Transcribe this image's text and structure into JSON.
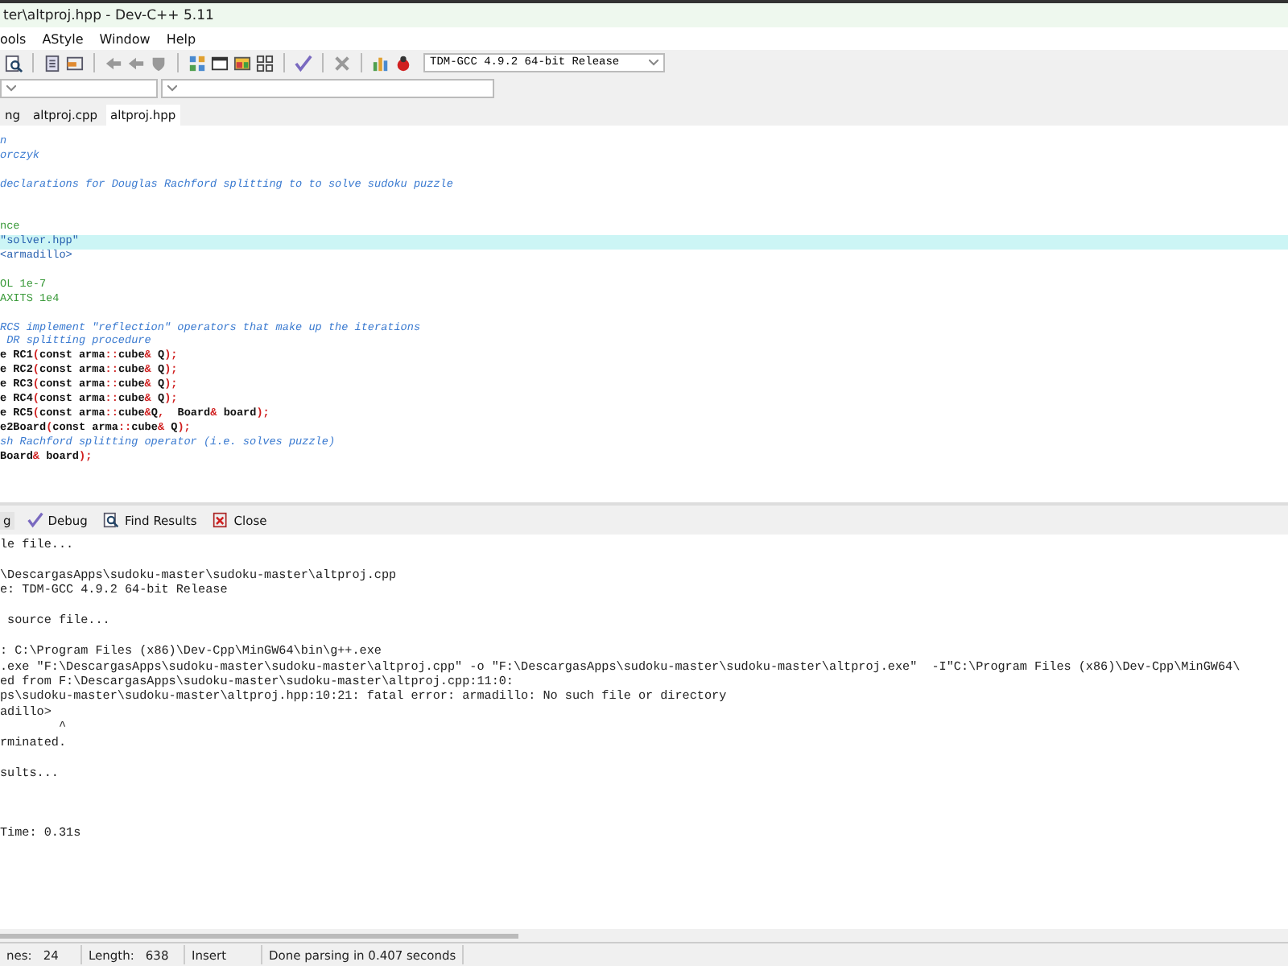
{
  "window": {
    "title": "ter\\altproj.hpp - Dev-C++ 5.11"
  },
  "menu": [
    "ools",
    "AStyle",
    "Window",
    "Help"
  ],
  "toolbar": {
    "compiler": "TDM-GCC 4.9.2 64-bit Release"
  },
  "editor_tabs": [
    {
      "label": "ng",
      "selected": false
    },
    {
      "label": "altproj.cpp",
      "selected": false
    },
    {
      "label": "altproj.hpp",
      "selected": true
    }
  ],
  "code_lines": [
    {
      "highlighted": false,
      "segments": [
        {
          "text": "n",
          "kind": "comment"
        }
      ]
    },
    {
      "highlighted": false,
      "segments": [
        {
          "text": "orczyk",
          "kind": "comment"
        }
      ]
    },
    {
      "kind": "blank"
    },
    {
      "highlighted": false,
      "segments": [
        {
          "text": "declarations for Douglas Rachford splitting to to solve sudoku puzzle",
          "kind": "comment"
        }
      ]
    },
    {
      "kind": "blank"
    },
    {
      "kind": "blank"
    },
    {
      "highlighted": false,
      "segments": [
        {
          "text": "nce",
          "kind": "preproc"
        }
      ]
    },
    {
      "highlighted": true,
      "segments": [
        {
          "text": "\"solver.hpp\"",
          "kind": "string"
        }
      ]
    },
    {
      "highlighted": false,
      "segments": [
        {
          "text": "<armadillo>",
          "kind": "string"
        }
      ]
    },
    {
      "kind": "blank"
    },
    {
      "highlighted": false,
      "segments": [
        {
          "text": "OL 1e-7",
          "kind": "preproc"
        }
      ]
    },
    {
      "highlighted": false,
      "segments": [
        {
          "text": "AXITS 1e4",
          "kind": "preproc"
        }
      ]
    },
    {
      "kind": "blank"
    },
    {
      "highlighted": false,
      "segments": [
        {
          "text": "RCS implement \"reflection\" operators that make up the iterations",
          "kind": "comment"
        }
      ]
    },
    {
      "highlighted": false,
      "segments": [
        {
          "text": " DR splitting procedure",
          "kind": "comment"
        }
      ]
    },
    {
      "highlighted": false,
      "segments": [
        {
          "text": "e RC1",
          "kind": "plain"
        },
        {
          "text": "(",
          "kind": "symbol"
        },
        {
          "text": "const arma",
          "kind": "plain"
        },
        {
          "text": "::",
          "kind": "symbol"
        },
        {
          "text": "cube",
          "kind": "plain"
        },
        {
          "text": "&",
          "kind": "symbol"
        },
        {
          "text": " Q",
          "kind": "plain"
        },
        {
          "text": ");",
          "kind": "symbol"
        }
      ]
    },
    {
      "highlighted": false,
      "segments": [
        {
          "text": "e RC2",
          "kind": "plain"
        },
        {
          "text": "(",
          "kind": "symbol"
        },
        {
          "text": "const arma",
          "kind": "plain"
        },
        {
          "text": "::",
          "kind": "symbol"
        },
        {
          "text": "cube",
          "kind": "plain"
        },
        {
          "text": "&",
          "kind": "symbol"
        },
        {
          "text": " Q",
          "kind": "plain"
        },
        {
          "text": ");",
          "kind": "symbol"
        }
      ]
    },
    {
      "highlighted": false,
      "segments": [
        {
          "text": "e RC3",
          "kind": "plain"
        },
        {
          "text": "(",
          "kind": "symbol"
        },
        {
          "text": "const arma",
          "kind": "plain"
        },
        {
          "text": "::",
          "kind": "symbol"
        },
        {
          "text": "cube",
          "kind": "plain"
        },
        {
          "text": "&",
          "kind": "symbol"
        },
        {
          "text": " Q",
          "kind": "plain"
        },
        {
          "text": ");",
          "kind": "symbol"
        }
      ]
    },
    {
      "highlighted": false,
      "segments": [
        {
          "text": "e RC4",
          "kind": "plain"
        },
        {
          "text": "(",
          "kind": "symbol"
        },
        {
          "text": "const arma",
          "kind": "plain"
        },
        {
          "text": "::",
          "kind": "symbol"
        },
        {
          "text": "cube",
          "kind": "plain"
        },
        {
          "text": "&",
          "kind": "symbol"
        },
        {
          "text": " Q",
          "kind": "plain"
        },
        {
          "text": ");",
          "kind": "symbol"
        }
      ]
    },
    {
      "highlighted": false,
      "segments": [
        {
          "text": "e RC5",
          "kind": "plain"
        },
        {
          "text": "(",
          "kind": "symbol"
        },
        {
          "text": "const arma",
          "kind": "plain"
        },
        {
          "text": "::",
          "kind": "symbol"
        },
        {
          "text": "cube",
          "kind": "plain"
        },
        {
          "text": "&",
          "kind": "symbol"
        },
        {
          "text": "Q",
          "kind": "plain"
        },
        {
          "text": ",",
          "kind": "symbol"
        },
        {
          "text": "  Board",
          "kind": "plain"
        },
        {
          "text": "&",
          "kind": "symbol"
        },
        {
          "text": " board",
          "kind": "plain"
        },
        {
          "text": ");",
          "kind": "symbol"
        }
      ]
    },
    {
      "highlighted": false,
      "segments": [
        {
          "text": "e2Board",
          "kind": "plain"
        },
        {
          "text": "(",
          "kind": "symbol"
        },
        {
          "text": "const arma",
          "kind": "plain"
        },
        {
          "text": "::",
          "kind": "symbol"
        },
        {
          "text": "cube",
          "kind": "plain"
        },
        {
          "text": "&",
          "kind": "symbol"
        },
        {
          "text": " Q",
          "kind": "plain"
        },
        {
          "text": ");",
          "kind": "symbol"
        }
      ]
    },
    {
      "highlighted": false,
      "segments": [
        {
          "text": "sh Rachford splitting operator (i.e. solves puzzle)",
          "kind": "comment"
        }
      ]
    },
    {
      "highlighted": false,
      "segments": [
        {
          "text": "Board",
          "kind": "plain"
        },
        {
          "text": "&",
          "kind": "symbol"
        },
        {
          "text": " board",
          "kind": "plain"
        },
        {
          "text": ");",
          "kind": "symbol"
        }
      ]
    }
  ],
  "output_tabs": [
    {
      "label": "g",
      "kind": "log",
      "selected": true
    },
    {
      "label": "Debug",
      "kind": "debug",
      "selected": false
    },
    {
      "label": "Find Results",
      "kind": "find",
      "selected": false
    },
    {
      "label": "Close",
      "kind": "close",
      "selected": false
    }
  ],
  "output_lines": [
    {
      "kind": "text",
      "text": "le file..."
    },
    {
      "kind": "blank"
    },
    {
      "kind": "text",
      "text": "\\DescargasApps\\sudoku-master\\sudoku-master\\altproj.cpp"
    },
    {
      "kind": "text",
      "text": "e: TDM-GCC 4.9.2 64-bit Release"
    },
    {
      "kind": "blank"
    },
    {
      "kind": "text",
      "text": " source file..."
    },
    {
      "kind": "blank"
    },
    {
      "kind": "text",
      "text": ": C:\\Program Files (x86)\\Dev-Cpp\\MinGW64\\bin\\g++.exe"
    },
    {
      "kind": "text",
      "text": ".exe \"F:\\DescargasApps\\sudoku-master\\sudoku-master\\altproj.cpp\" -o \"F:\\DescargasApps\\sudoku-master\\sudoku-master\\altproj.exe\"  -I\"C:\\Program Files (x86)\\Dev-Cpp\\MinGW64\\"
    },
    {
      "kind": "text",
      "text": "ed from F:\\DescargasApps\\sudoku-master\\sudoku-master\\altproj.cpp:11:0:"
    },
    {
      "kind": "text",
      "text": "ps\\sudoku-master\\sudoku-master\\altproj.hpp:10:21: fatal error: armadillo: No such file or directory"
    },
    {
      "kind": "text",
      "text": "adillo>"
    },
    {
      "kind": "text",
      "text": "        ^"
    },
    {
      "kind": "text",
      "text": "rminated."
    },
    {
      "kind": "blank"
    },
    {
      "kind": "text",
      "text": "sults..."
    },
    {
      "kind": "blank"
    },
    {
      "kind": "blank"
    },
    {
      "kind": "blank"
    },
    {
      "kind": "text",
      "text": "Time: 0.31s"
    }
  ],
  "status_bar": [
    {
      "label": "nes:",
      "value": "24"
    },
    {
      "label": "Length:",
      "value": "638"
    },
    {
      "value": "Insert"
    },
    {
      "value": "Done parsing in 0.407 seconds"
    }
  ]
}
